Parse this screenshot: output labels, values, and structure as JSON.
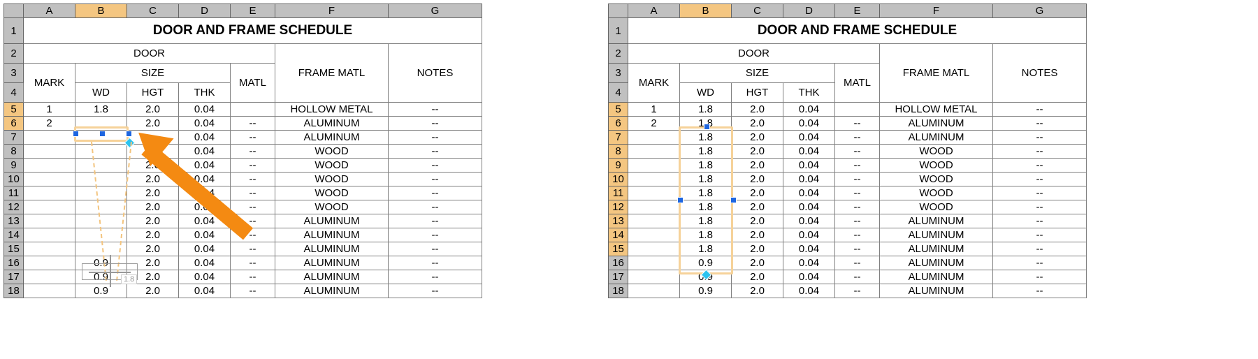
{
  "columns": [
    "A",
    "B",
    "C",
    "D",
    "E",
    "F",
    "G"
  ],
  "title": "DOOR AND FRAME SCHEDULE",
  "headers": {
    "door": "DOOR",
    "size": "SIZE",
    "mark": "MARK",
    "wd": "WD",
    "hgt": "HGT",
    "thk": "THK",
    "matl": "MATL",
    "frame_matl": "FRAME MATL",
    "notes": "NOTES"
  },
  "left": {
    "selected_col": "B",
    "selected_rows_start": 5,
    "selected_rows_end": 6,
    "ghost_label": "1.8",
    "rows": [
      {
        "n": 5,
        "a": "1",
        "b": "1.8",
        "c": "2.0",
        "d": "0.04",
        "e": "",
        "f": "HOLLOW METAL",
        "g": "--"
      },
      {
        "n": 6,
        "a": "2",
        "b": "",
        "c": "2.0",
        "d": "0.04",
        "e": "--",
        "f": "ALUMINUM",
        "g": "--"
      },
      {
        "n": 7,
        "a": "",
        "b": "",
        "c": "",
        "d": "0.04",
        "e": "--",
        "f": "ALUMINUM",
        "g": "--"
      },
      {
        "n": 8,
        "a": "",
        "b": "",
        "c": "2.0",
        "d": "0.04",
        "e": "--",
        "f": "WOOD",
        "g": "--"
      },
      {
        "n": 9,
        "a": "",
        "b": "",
        "c": "2.0",
        "d": "0.04",
        "e": "--",
        "f": "WOOD",
        "g": "--"
      },
      {
        "n": 10,
        "a": "",
        "b": "",
        "c": "2.0",
        "d": "0.04",
        "e": "--",
        "f": "WOOD",
        "g": "--"
      },
      {
        "n": 11,
        "a": "",
        "b": "",
        "c": "2.0",
        "d": "0.04",
        "e": "--",
        "f": "WOOD",
        "g": "--"
      },
      {
        "n": 12,
        "a": "",
        "b": "",
        "c": "2.0",
        "d": "0.04",
        "e": "--",
        "f": "WOOD",
        "g": "--"
      },
      {
        "n": 13,
        "a": "",
        "b": "",
        "c": "2.0",
        "d": "0.04",
        "e": "--",
        "f": "ALUMINUM",
        "g": "--"
      },
      {
        "n": 14,
        "a": "",
        "b": "",
        "c": "2.0",
        "d": "0.04",
        "e": "--",
        "f": "ALUMINUM",
        "g": "--"
      },
      {
        "n": 15,
        "a": "",
        "b": "",
        "c": "2.0",
        "d": "0.04",
        "e": "--",
        "f": "ALUMINUM",
        "g": "--"
      },
      {
        "n": 16,
        "a": "",
        "b": "0.9",
        "c": "2.0",
        "d": "0.04",
        "e": "--",
        "f": "ALUMINUM",
        "g": "--"
      },
      {
        "n": 17,
        "a": "",
        "b": "0.9",
        "c": "2.0",
        "d": "0.04",
        "e": "--",
        "f": "ALUMINUM",
        "g": "--"
      },
      {
        "n": 18,
        "a": "",
        "b": "0.9",
        "c": "2.0",
        "d": "0.04",
        "e": "--",
        "f": "ALUMINUM",
        "g": "--"
      }
    ]
  },
  "right": {
    "selected_col": "B",
    "selected_rows_start": 5,
    "selected_rows_end": 15,
    "rows": [
      {
        "n": 5,
        "a": "1",
        "b": "1.8",
        "c": "2.0",
        "d": "0.04",
        "e": "",
        "f": "HOLLOW METAL",
        "g": "--"
      },
      {
        "n": 6,
        "a": "2",
        "b": "1.8",
        "c": "2.0",
        "d": "0.04",
        "e": "--",
        "f": "ALUMINUM",
        "g": "--"
      },
      {
        "n": 7,
        "a": "",
        "b": "1.8",
        "c": "2.0",
        "d": "0.04",
        "e": "--",
        "f": "ALUMINUM",
        "g": "--"
      },
      {
        "n": 8,
        "a": "",
        "b": "1.8",
        "c": "2.0",
        "d": "0.04",
        "e": "--",
        "f": "WOOD",
        "g": "--"
      },
      {
        "n": 9,
        "a": "",
        "b": "1.8",
        "c": "2.0",
        "d": "0.04",
        "e": "--",
        "f": "WOOD",
        "g": "--"
      },
      {
        "n": 10,
        "a": "",
        "b": "1.8",
        "c": "2.0",
        "d": "0.04",
        "e": "--",
        "f": "WOOD",
        "g": "--"
      },
      {
        "n": 11,
        "a": "",
        "b": "1.8",
        "c": "2.0",
        "d": "0.04",
        "e": "--",
        "f": "WOOD",
        "g": "--"
      },
      {
        "n": 12,
        "a": "",
        "b": "1.8",
        "c": "2.0",
        "d": "0.04",
        "e": "--",
        "f": "WOOD",
        "g": "--"
      },
      {
        "n": 13,
        "a": "",
        "b": "1.8",
        "c": "2.0",
        "d": "0.04",
        "e": "--",
        "f": "ALUMINUM",
        "g": "--"
      },
      {
        "n": 14,
        "a": "",
        "b": "1.8",
        "c": "2.0",
        "d": "0.04",
        "e": "--",
        "f": "ALUMINUM",
        "g": "--"
      },
      {
        "n": 15,
        "a": "",
        "b": "1.8",
        "c": "2.0",
        "d": "0.04",
        "e": "--",
        "f": "ALUMINUM",
        "g": "--"
      },
      {
        "n": 16,
        "a": "",
        "b": "0.9",
        "c": "2.0",
        "d": "0.04",
        "e": "--",
        "f": "ALUMINUM",
        "g": "--"
      },
      {
        "n": 17,
        "a": "",
        "b": "0.9",
        "c": "2.0",
        "d": "0.04",
        "e": "--",
        "f": "ALUMINUM",
        "g": "--"
      },
      {
        "n": 18,
        "a": "",
        "b": "0.9",
        "c": "2.0",
        "d": "0.04",
        "e": "--",
        "f": "ALUMINUM",
        "g": "--"
      }
    ]
  }
}
